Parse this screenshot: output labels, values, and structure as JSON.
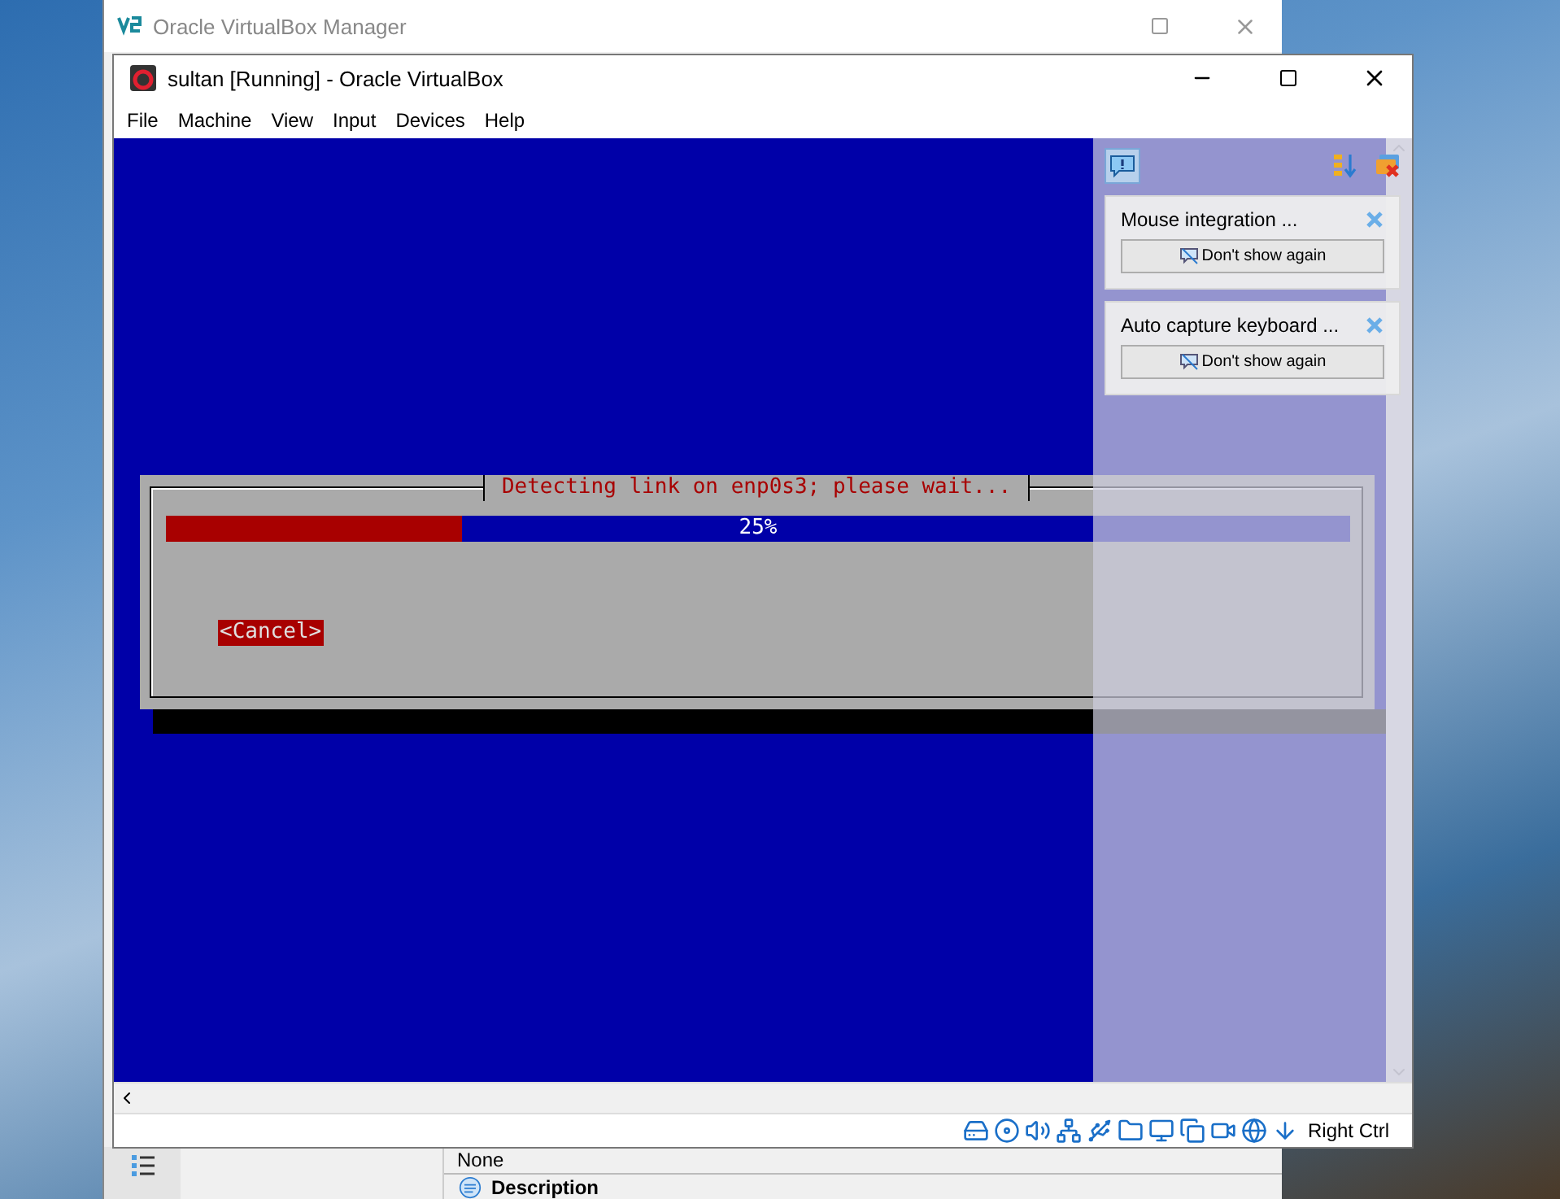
{
  "manager_window": {
    "title": "Oracle VirtualBox Manager",
    "details_value": "None",
    "section_heading": "Description"
  },
  "vm_window": {
    "title": "sultan [Running] - Oracle VirtualBox",
    "menu": [
      "File",
      "Machine",
      "View",
      "Input",
      "Devices",
      "Help"
    ]
  },
  "installer_dialog": {
    "title": "Detecting link on enp0s3; please wait...",
    "progress": {
      "level": 0.25,
      "reading": "25%"
    },
    "buttons": [
      {
        "label": "<Cancel>",
        "selected": true
      }
    ]
  },
  "notifications": [
    {
      "message": "Mouse integration ...",
      "button": "Don't show again"
    },
    {
      "message": "Auto capture keyboard ...",
      "button": "Don't show again"
    }
  ],
  "status_bar": {
    "host_key": "Right Ctrl"
  }
}
